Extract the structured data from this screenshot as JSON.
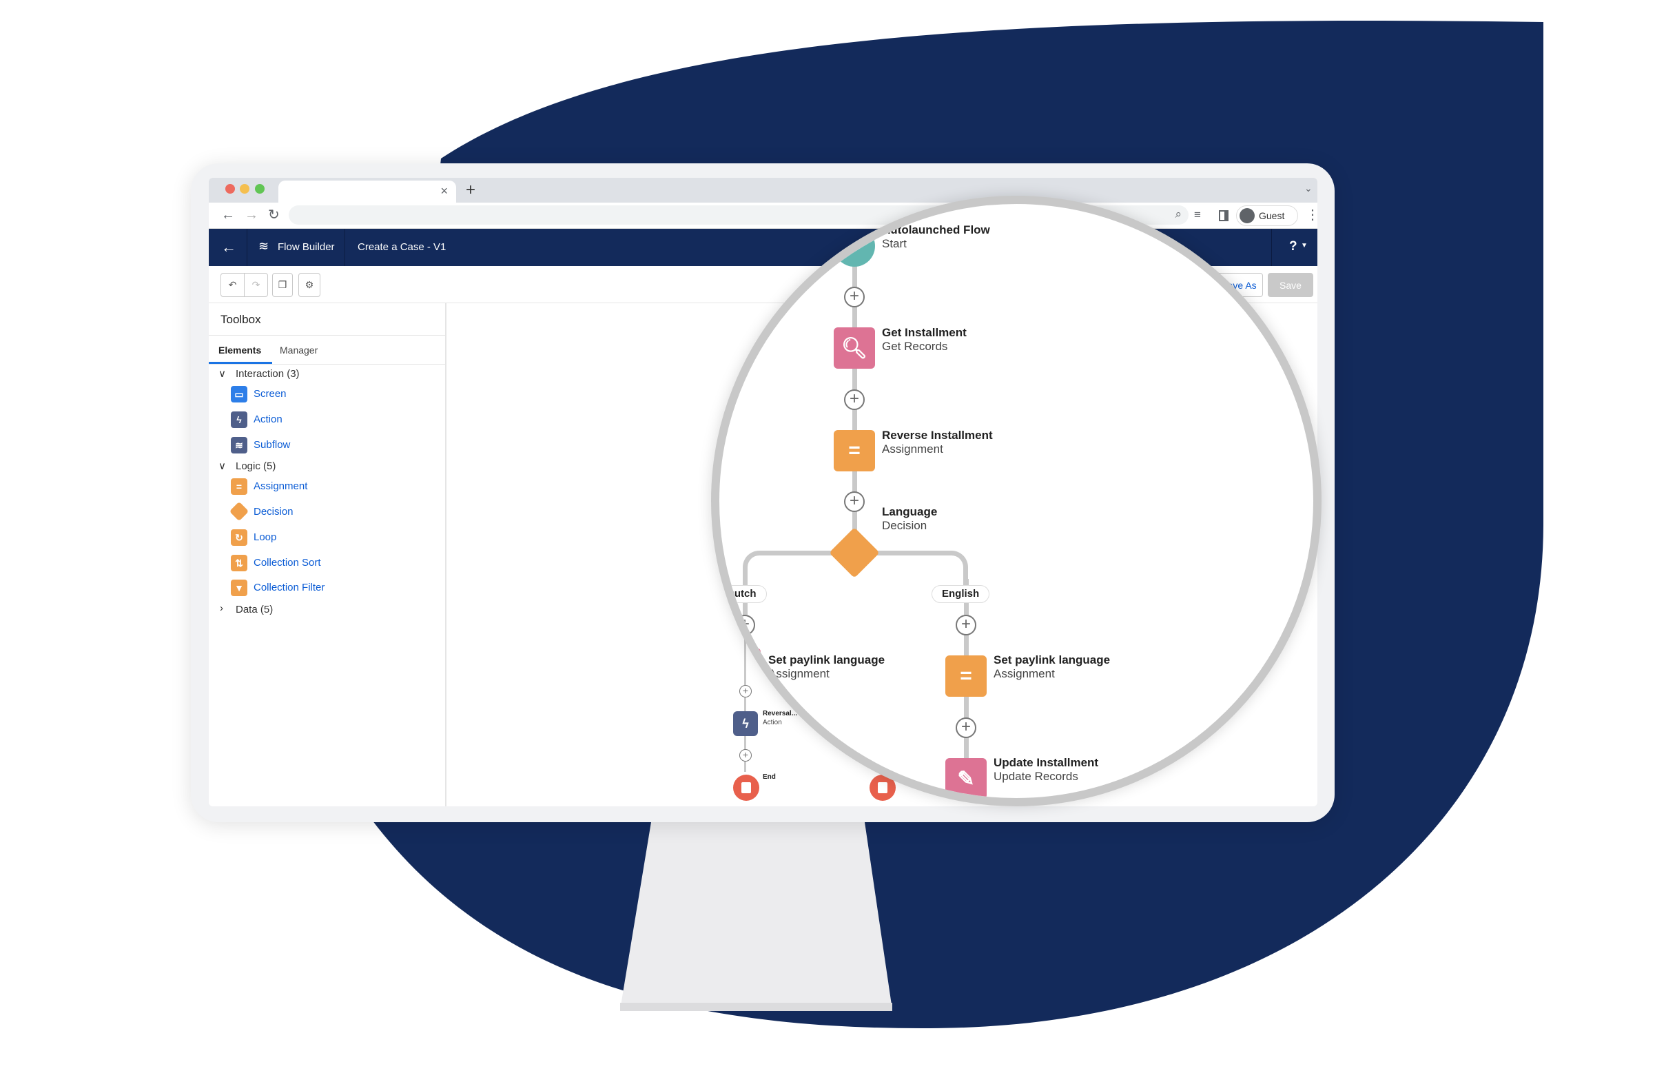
{
  "colors": {
    "navy": "#132a5b",
    "assignment": "#f0a04b",
    "records": "#dd7394",
    "action": "#4f5f8a",
    "screen": "#2d7ee8",
    "start": "#62b6b0",
    "end": "#e8604c"
  },
  "browser": {
    "tab_close": "×",
    "new_tab": "+",
    "profile": "Guest"
  },
  "header": {
    "app": "Flow Builder",
    "flow": "Create a Case - V1",
    "help": "?"
  },
  "toolbar": {
    "save_as": "Save As",
    "save": "Save"
  },
  "toolbox": {
    "title": "Toolbox",
    "tabs": [
      "Elements",
      "Manager"
    ],
    "groups": [
      {
        "label": "Interaction (3)",
        "items": [
          "Screen",
          "Action",
          "Subflow"
        ]
      },
      {
        "label": "Logic (5)",
        "items": [
          "Assignment",
          "Decision",
          "Loop",
          "Collection Sort",
          "Collection Filter"
        ]
      },
      {
        "label": "Data (5)"
      }
    ]
  },
  "flow": {
    "start": {
      "title": "Autolaunched Flow",
      "sub": "Start"
    },
    "get": {
      "title": "Get Installment",
      "sub": "Get Records"
    },
    "reverse": {
      "title": "Reverse Installment",
      "sub": "Assignment"
    },
    "decision": {
      "title": "Language",
      "sub": "Decision"
    },
    "branches": [
      "Dutch",
      "English"
    ],
    "set_left": {
      "title": "Set paylink language",
      "sub": "Assignment"
    },
    "action_left": {
      "title": "Reversal...",
      "sub": "Action"
    },
    "end": {
      "title": "End"
    },
    "set_right": {
      "title": "Set paylink language",
      "sub": "Assignment"
    },
    "update": {
      "title": "Update Installment",
      "sub": "Update Records"
    }
  }
}
